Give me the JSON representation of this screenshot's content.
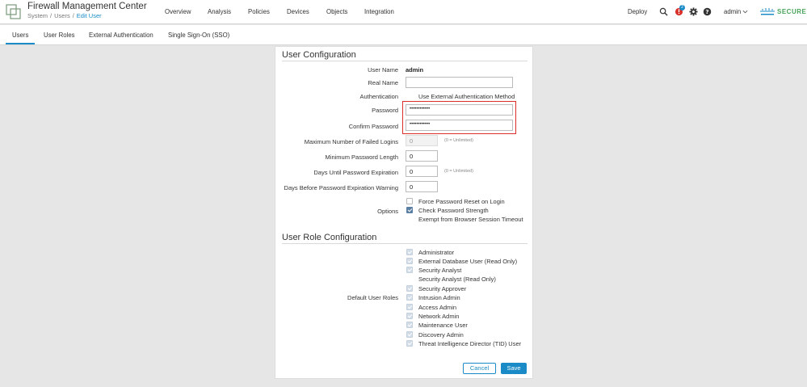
{
  "header": {
    "title": "Firewall Management Center",
    "breadcrumb": [
      "System",
      "Users",
      "Edit User"
    ],
    "nav": [
      "Overview",
      "Analysis",
      "Policies",
      "Devices",
      "Objects",
      "Integration"
    ],
    "deploy_label": "Deploy",
    "alerts_count": "2",
    "user": "admin",
    "brand": "SECURE"
  },
  "tabs": [
    "Users",
    "User Roles",
    "External Authentication",
    "Single Sign-On (SSO)"
  ],
  "active_tab": "Users",
  "user_config": {
    "title": "User Configuration",
    "user_name_label": "User Name",
    "user_name": "admin",
    "real_name_label": "Real Name",
    "real_name": "",
    "auth_label": "Authentication",
    "auth_option": "Use External Authentication Method",
    "password_label": "Password",
    "password_value": "••••••••••••",
    "confirm_label": "Confirm Password",
    "confirm_value": "••••••••••••",
    "max_failed_label": "Maximum Number of Failed Logins",
    "max_failed_value": "0",
    "unlimited_hint": "(0 = Unlimited)",
    "min_len_label": "Minimum Password Length",
    "min_len_value": "0",
    "days_exp_label": "Days Until Password Expiration",
    "days_exp_value": "0",
    "days_warn_label": "Days Before Password Expiration Warning",
    "days_warn_value": "0",
    "options_label": "Options",
    "options": [
      {
        "label": "Force Password Reset on Login",
        "checked": false
      },
      {
        "label": "Check Password Strength",
        "checked": true
      },
      {
        "label": "Exempt from Browser Session Timeout",
        "checked": false
      }
    ]
  },
  "role_config": {
    "title": "User Role Configuration",
    "default_roles_label": "Default User Roles",
    "roles": [
      {
        "label": "Administrator",
        "checked": true
      },
      {
        "label": "External Database User (Read Only)",
        "checked": true
      },
      {
        "label": "Security Analyst",
        "checked": true
      },
      {
        "label": "Security Analyst (Read Only)",
        "checked": false
      },
      {
        "label": "Security Approver",
        "checked": true
      },
      {
        "label": "Intrusion Admin",
        "checked": true
      },
      {
        "label": "Access Admin",
        "checked": true
      },
      {
        "label": "Network Admin",
        "checked": true
      },
      {
        "label": "Maintenance User",
        "checked": true
      },
      {
        "label": "Discovery Admin",
        "checked": true
      },
      {
        "label": "Threat Intelligence Director (TID) User",
        "checked": true
      }
    ]
  },
  "buttons": {
    "cancel": "Cancel",
    "save": "Save"
  },
  "colors": {
    "accent": "#1a8bc7",
    "highlight": "#d9302a",
    "brand_green": "#49a35a"
  }
}
